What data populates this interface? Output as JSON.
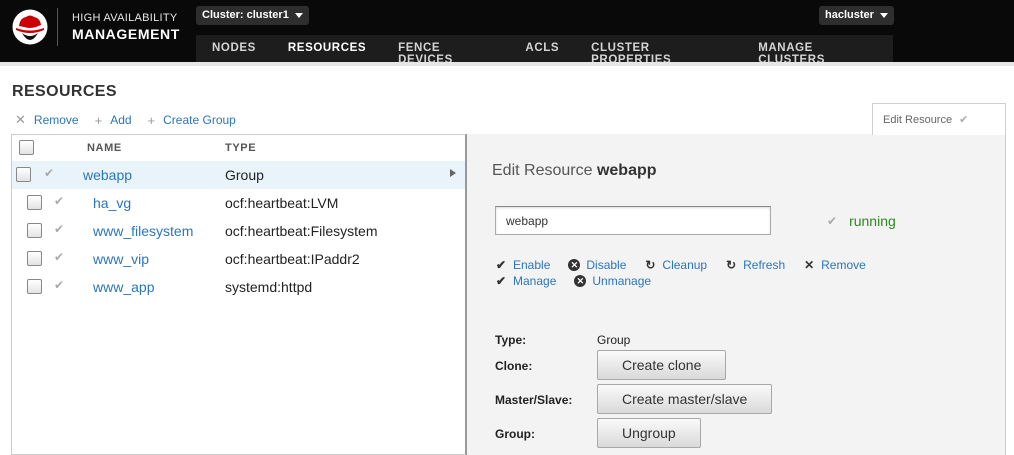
{
  "header": {
    "brand_line1": "HIGH AVAILABILITY",
    "brand_line2": "MANAGEMENT",
    "cluster_select": "Cluster: cluster1",
    "user": "hacluster",
    "nav": [
      {
        "label": "NODES"
      },
      {
        "label": "RESOURCES"
      },
      {
        "label": "FENCE DEVICES"
      },
      {
        "label": "ACLS"
      },
      {
        "label": "CLUSTER PROPERTIES"
      },
      {
        "label": "MANAGE CLUSTERS"
      }
    ],
    "active_nav": "RESOURCES"
  },
  "page": {
    "title": "RESOURCES",
    "toolbar": {
      "remove": "Remove",
      "add": "Add",
      "create_group": "Create Group"
    },
    "edit_tab": "Edit Resource"
  },
  "list": {
    "col_name": "NAME",
    "col_type": "TYPE",
    "rows": [
      {
        "name": "webapp",
        "type": "Group"
      },
      {
        "name": "ha_vg",
        "type": "ocf:heartbeat:LVM"
      },
      {
        "name": "www_filesystem",
        "type": "ocf:heartbeat:Filesystem"
      },
      {
        "name": "www_vip",
        "type": "ocf:heartbeat:IPaddr2"
      },
      {
        "name": "www_app",
        "type": "systemd:httpd"
      }
    ]
  },
  "detail": {
    "title_prefix": "Edit Resource",
    "title_name": "webapp",
    "name_value": "webapp",
    "status": "running",
    "actions": {
      "enable": "Enable",
      "disable": "Disable",
      "cleanup": "Cleanup",
      "refresh": "Refresh",
      "remove": "Remove",
      "manage": "Manage",
      "unmanage": "Unmanage"
    },
    "type_label": "Type:",
    "type_value": "Group",
    "clone_label": "Clone:",
    "clone_button": "Create clone",
    "master_label": "Master/Slave:",
    "master_button": "Create master/slave",
    "group_label": "Group:",
    "group_button": "Ungroup"
  },
  "colors": {
    "header_bg": "#090909",
    "link": "#2a76bc",
    "running": "#2a8a1d",
    "selected_row": "#e8f3fa",
    "logo_red": "#cc0000"
  }
}
